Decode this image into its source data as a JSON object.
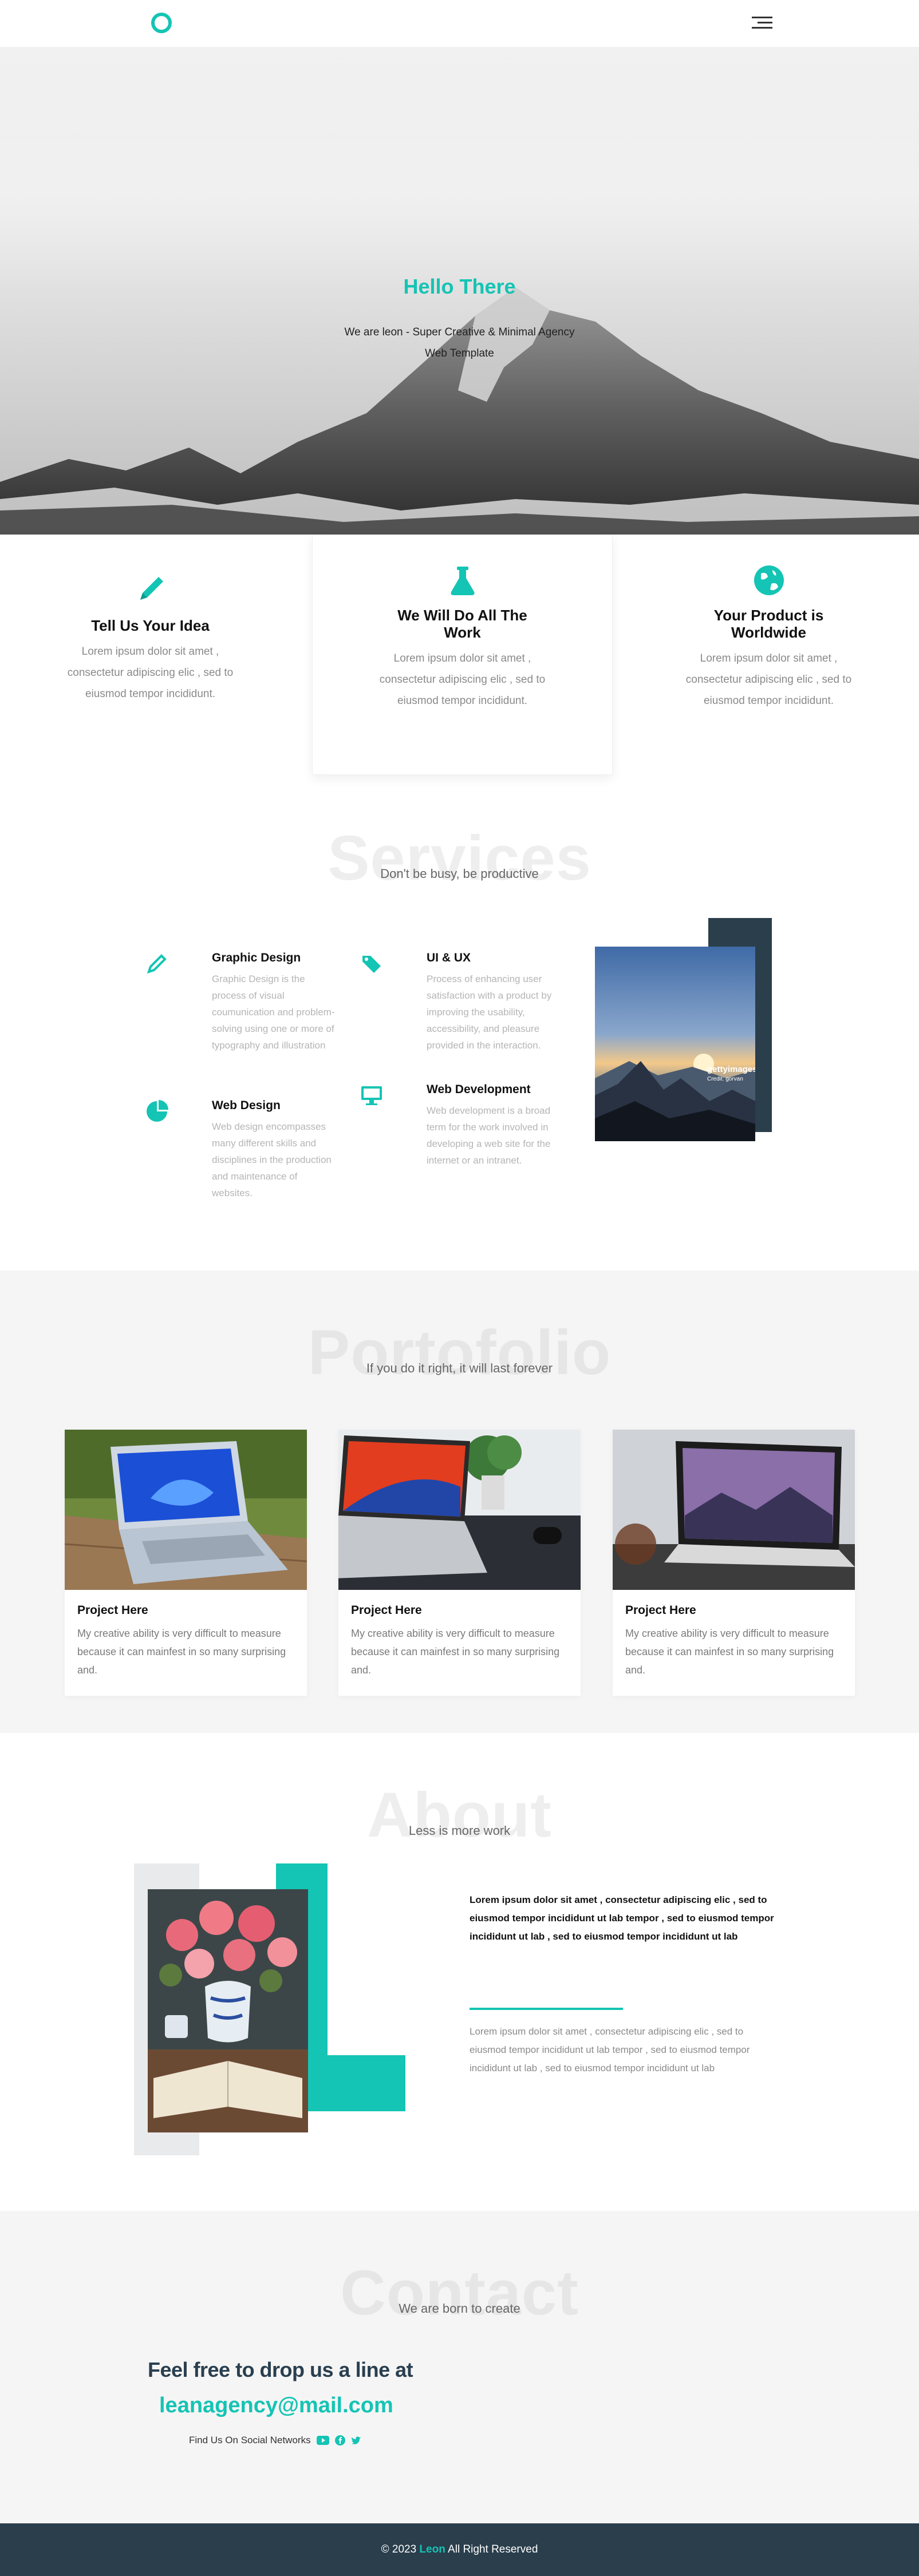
{
  "nav": {
    "logo_icon": "ring-logo-icon",
    "menu_icon": "hamburger-menu-icon"
  },
  "hero": {
    "title": "Hello There",
    "subtitle": "We are leon - Super Creative & Minimal Agency Web Template"
  },
  "features": [
    {
      "icon": "pencil-icon",
      "title": "Tell Us Your Idea",
      "text": "Lorem ipsum dolor sit amet , consectetur adipiscing elic , sed to eiusmod tempor incididunt."
    },
    {
      "icon": "flask-icon",
      "title": "We Will Do All The Work",
      "text": "Lorem ipsum dolor sit amet , consectetur adipiscing elic , sed to eiusmod tempor incididunt."
    },
    {
      "icon": "globe-icon",
      "title": "Your Product is Worldwide",
      "text": "Lorem ipsum dolor sit amet , consectetur adipiscing elic , sed to eiusmod tempor incididunt."
    }
  ],
  "services": {
    "heading": "Services",
    "tagline": "Don't be busy, be productive",
    "items": [
      {
        "icon": "pencil-icon",
        "title": "Graphic Design",
        "text": "Graphic Design is the process of visual coumunication and problem-solving using one or more of typography and illustration"
      },
      {
        "icon": "tags-icon",
        "title": "UI & UX",
        "text": "Process of enhancing user satisfaction with a product by improving the usability, accessibility, and pleasure provided in the interaction."
      },
      {
        "icon": "pie-chart-icon",
        "title": "Web Design",
        "text": "Web design encompasses many different skills and disciplines in the production and maintenance of websites."
      },
      {
        "icon": "desktop-icon",
        "title": "Web Development",
        "text": "Web development is a broad term for the work involved in developing a web site for the internet or an intranet."
      }
    ],
    "image_watermark": "gettyimages",
    "image_credit": "Credit: gorvan"
  },
  "portfolio": {
    "heading": "Portofolio",
    "tagline": "If you do it right, it will last forever",
    "cards": [
      {
        "title": "Project Here",
        "text": "My creative ability is very difficult to measure because it can mainfest in so many surprising and."
      },
      {
        "title": "Project Here",
        "text": "My creative ability is very difficult to measure because it can mainfest in so many surprising and."
      },
      {
        "title": "Project Here",
        "text": "My creative ability is very difficult to measure because it can mainfest in so many surprising and."
      }
    ]
  },
  "about": {
    "heading": "About",
    "tagline": "Less is more work",
    "bold_text": "Lorem ipsum dolor sit amet , consectetur adipiscing elic , sed to eiusmod tempor incididunt ut lab tempor , sed to eiusmod tempor incididunt ut lab , sed to eiusmod tempor incididunt ut lab",
    "light_text": "Lorem ipsum dolor sit amet , consectetur adipiscing elic , sed to eiusmod tempor incididunt ut lab tempor , sed to eiusmod tempor incididunt ut lab , sed to eiusmod tempor incididunt ut lab"
  },
  "contact": {
    "heading": "Contact",
    "tagline": "We are born to create",
    "line1": "Feel free to drop us a line at",
    "email": "leanagency@mail.com",
    "social_label": "Find Us On Social Networks",
    "social_icons": [
      "youtube-icon",
      "facebook-icon",
      "twitter-icon"
    ]
  },
  "footer": {
    "prefix": "© 2023",
    "brand": "Leon",
    "suffix": "All Right Reserved"
  },
  "colors": {
    "accent": "#14c4b4",
    "dark": "#2a3e4c",
    "grey_bg": "#f5f5f5"
  }
}
